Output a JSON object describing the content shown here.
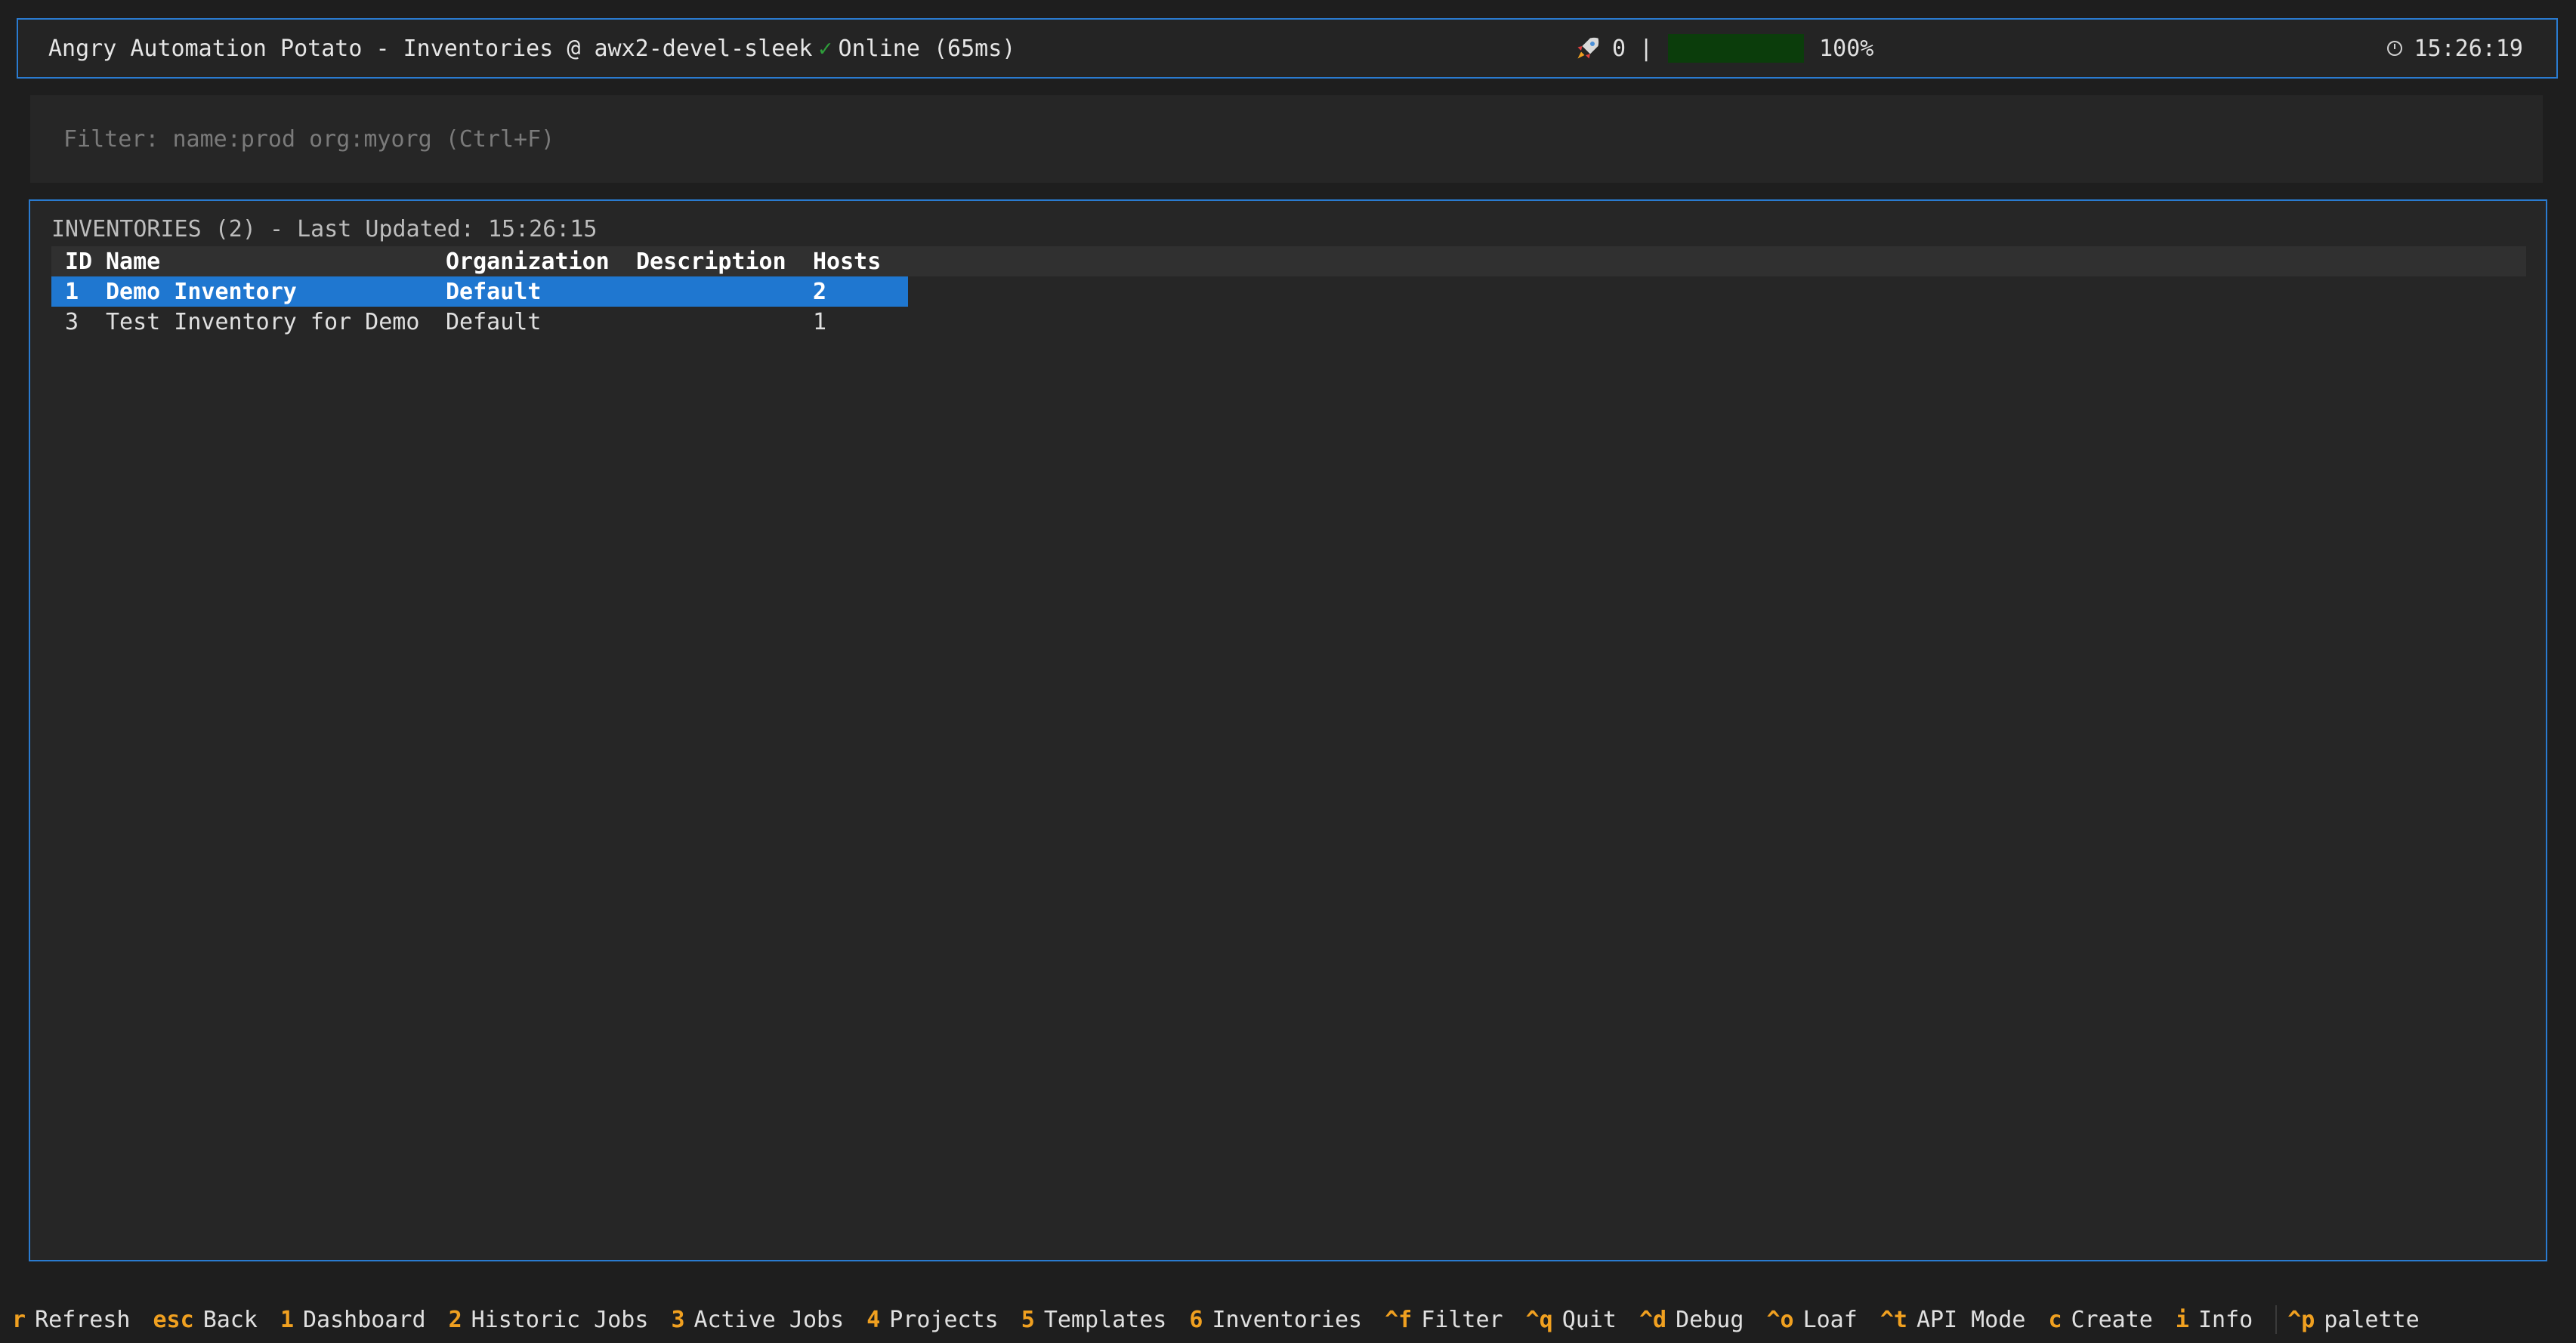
{
  "header": {
    "title": "Angry Automation Potato - Inventories @ awx2-devel-sleek",
    "check": "✓",
    "status": "Online (65ms)",
    "rocket_count": "0",
    "separator": "|",
    "progress_percent": 100,
    "progress_label": "100%",
    "time": "15:26:19",
    "progress_color": "#0aa50a"
  },
  "filter": {
    "placeholder": "Filter: name:prod org:myorg (Ctrl+F)",
    "value": ""
  },
  "inventories": {
    "title": "INVENTORIES (2) - Last Updated: 15:26:15",
    "columns": [
      "ID",
      "Name",
      "Organization",
      "Description",
      "Hosts"
    ],
    "rows": [
      {
        "id": "1",
        "name": "Demo Inventory",
        "organization": "Default",
        "description": "",
        "hosts": "2"
      },
      {
        "id": "3",
        "name": "Test Inventory for Demo",
        "organization": "Default",
        "description": "",
        "hosts": "1"
      }
    ],
    "selected_row_color": "#1f77d0"
  },
  "shortcuts": [
    {
      "key": "r",
      "label": "Refresh"
    },
    {
      "key": "esc",
      "label": "Back"
    },
    {
      "key": "1",
      "label": "Dashboard"
    },
    {
      "key": "2",
      "label": "Historic Jobs"
    },
    {
      "key": "3",
      "label": "Active Jobs"
    },
    {
      "key": "4",
      "label": "Projects"
    },
    {
      "key": "5",
      "label": "Templates"
    },
    {
      "key": "6",
      "label": "Inventories"
    },
    {
      "key": "^f",
      "label": "Filter"
    },
    {
      "key": "^q",
      "label": "Quit"
    },
    {
      "key": "^d",
      "label": "Debug"
    },
    {
      "key": "^o",
      "label": "Loaf"
    },
    {
      "key": "^t",
      "label": "API Mode"
    },
    {
      "key": "c",
      "label": "Create"
    },
    {
      "key": "i",
      "label": "Info"
    },
    {
      "key": "^p",
      "label": "palette"
    }
  ],
  "accent_color": "#2a7bd0",
  "shortcut_key_color": "#f0a020"
}
